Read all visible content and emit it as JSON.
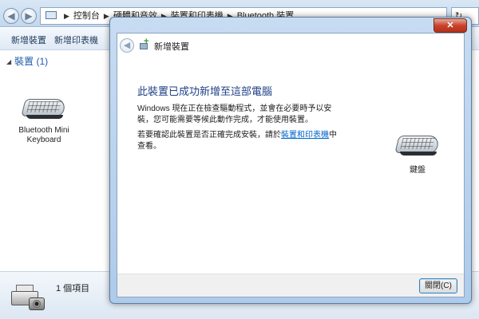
{
  "explorer": {
    "breadcrumb": [
      "控制台",
      "硬體和音效",
      "裝置和印表機",
      "Bluetooth 裝置"
    ],
    "toolbar": {
      "add_device": "新增裝置",
      "add_printer": "新增印表機"
    },
    "group_header": "裝置 (1)",
    "device_label": "Bluetooth Mini Keyboard",
    "status_count": "1 個項目"
  },
  "dialog": {
    "title": "新增裝置",
    "close_glyph": "✕",
    "heading": "此裝置已成功新增至這部電腦",
    "paragraph1": "Windows 現在正在檢查驅動程式，並會在必要時予以安裝，您可能需要等候此動作完成，才能使用裝置。",
    "paragraph2_prefix": "若要確認此裝置是否正確完成安裝，請於",
    "paragraph2_link": "裝置和印表機",
    "paragraph2_suffix": "中查看。",
    "device_label": "鍵盤",
    "close_button": "關閉(C)"
  },
  "icons": {
    "back": "back-arrow-icon",
    "forward": "forward-arrow-icon",
    "keyboard": "keyboard-icon",
    "printer": "printer-camera-icon",
    "wizard": "add-device-icon"
  },
  "colors": {
    "heading": "#1f3f86",
    "link": "#0066cc",
    "group_header": "#1e5ba8",
    "close_button_red": "#c8432b"
  }
}
